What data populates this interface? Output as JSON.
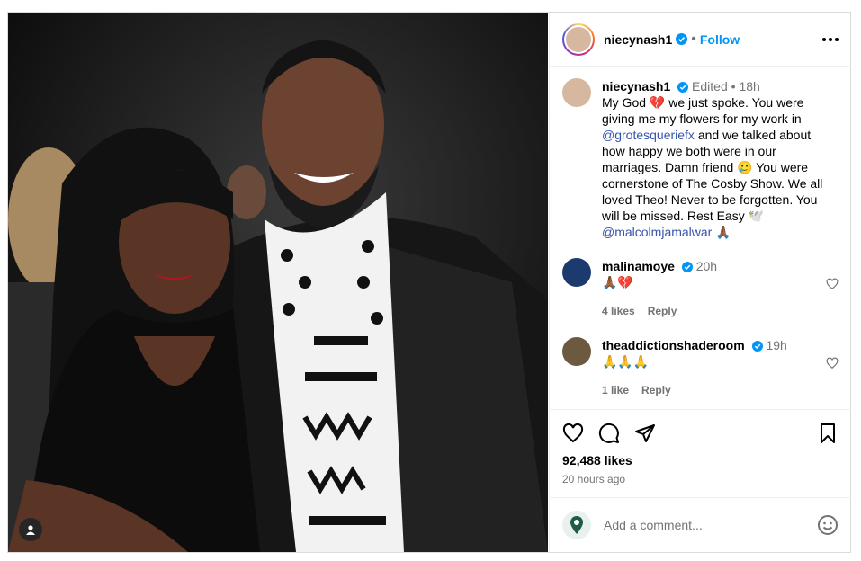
{
  "post": {
    "username": "niecynash1",
    "follow_label": "Follow",
    "separator": "•"
  },
  "caption": {
    "username": "niecynash1",
    "edited": "Edited",
    "separator": "•",
    "time": "18h",
    "t1": "My God 💔 we just spoke. You were giving me my flowers for my work in ",
    "mention1": "@grotesqueriefx",
    "t2": " and we talked about how happy we both were in our marriages. Damn friend 🥲 You were cornerstone of The Cosby Show. We all loved Theo! Never to be forgotten. You will be missed. Rest Easy 🕊️ ",
    "mention2": "@malcolmjamalwar",
    "t3": " 🙏🏾"
  },
  "comments": [
    {
      "username": "malinamoye",
      "time": "20h",
      "text": "🙏🏾💔",
      "likes": "4 likes",
      "reply": "Reply"
    },
    {
      "username": "theaddictionshaderoom",
      "time": "19h",
      "text": "🙏🙏🙏",
      "likes": "1 like",
      "reply": "Reply"
    }
  ],
  "stats": {
    "likes": "92,488 likes",
    "posted": "20 hours ago"
  },
  "composer": {
    "placeholder": "Add a comment..."
  },
  "colors": {
    "link": "#3555ab",
    "follow": "#0095f6",
    "verified": "#0095f6",
    "muted": "#737373"
  },
  "icons": [
    "heart-icon",
    "comment-icon",
    "share-icon",
    "bookmark-icon",
    "more-icon",
    "verified-icon",
    "emoji-icon",
    "user-tag-icon"
  ]
}
